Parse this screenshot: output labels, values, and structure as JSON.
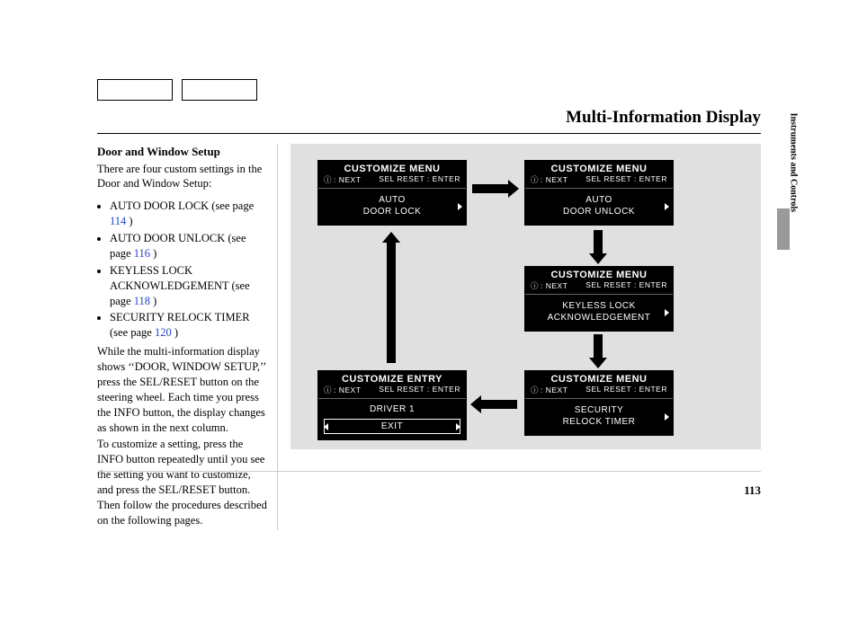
{
  "header": {
    "title": "Multi-Information Display"
  },
  "sidebar": {
    "section_label": "Instruments and Controls"
  },
  "page_number": "113",
  "text": {
    "subheading": "Door and Window Setup",
    "intro": "There are four custom settings in the Door and Window Setup:",
    "items": [
      {
        "label": "AUTO DOOR LOCK (see page ",
        "link": "114",
        "tail": " )"
      },
      {
        "label": "AUTO DOOR UNLOCK (see page ",
        "link": "116",
        "tail": " )"
      },
      {
        "label": "KEYLESS LOCK ACKNOWLEDGEMENT (see page ",
        "link": "118",
        "tail": " )"
      },
      {
        "label": "SECURITY RELOCK TIMER (see page ",
        "link": "120",
        "tail": " )"
      }
    ],
    "para2": "While the multi-information display shows ‘‘DOOR, WINDOW SETUP,’’ press the SEL/RESET button on the steering wheel. Each time you press the INFO button, the display changes as shown in the next column.",
    "para3": "To customize a setting, press the INFO button repeatedly until you see the setting you want to customize, and press the SEL/RESET button. Then follow the procedures described on the following pages."
  },
  "screens": {
    "sub_next": ": NEXT",
    "sub_enter": "SEL RESET : ENTER",
    "menu_title": "CUSTOMIZE MENU",
    "entry_title": "CUSTOMIZE ENTRY",
    "s1_line1": "AUTO",
    "s1_line2": "DOOR LOCK",
    "s2_line1": "AUTO",
    "s2_line2": "DOOR UNLOCK",
    "s3_line1": "KEYLESS LOCK",
    "s3_line2": "ACKNOWLEDGEMENT",
    "s4_line1": "SECURITY",
    "s4_line2": "RELOCK TIMER",
    "entry_driver": "DRIVER 1",
    "entry_exit": "EXIT"
  }
}
